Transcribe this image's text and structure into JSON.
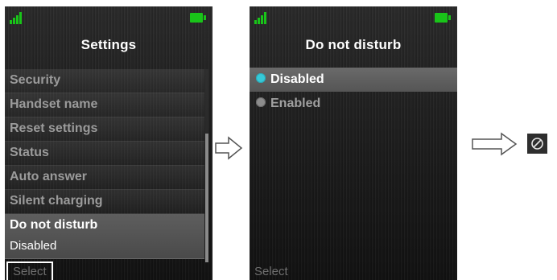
{
  "colors": {
    "signal": "#19c419",
    "battery": "#19c419",
    "radio_selected": "#36c9d8",
    "radio_unselected": "#8c8c8c"
  },
  "screen_left": {
    "title": "Settings",
    "items": [
      {
        "label": "Security"
      },
      {
        "label": "Handset name"
      },
      {
        "label": "Reset settings"
      },
      {
        "label": "Status"
      },
      {
        "label": "Auto answer"
      },
      {
        "label": "Silent charging"
      }
    ],
    "selected_item": {
      "label": "Do not disturb",
      "value": "Disabled"
    },
    "softkey": "Select"
  },
  "screen_right": {
    "title": "Do not disturb",
    "options": [
      {
        "label": "Disabled",
        "selected": true
      },
      {
        "label": "Enabled",
        "selected": false
      }
    ],
    "softkey": "Select"
  },
  "icons": {
    "signal": "signal-strength-icon",
    "battery": "battery-icon",
    "arrow": "right-arrow-icon",
    "dnd": "do-not-disturb-icon"
  }
}
